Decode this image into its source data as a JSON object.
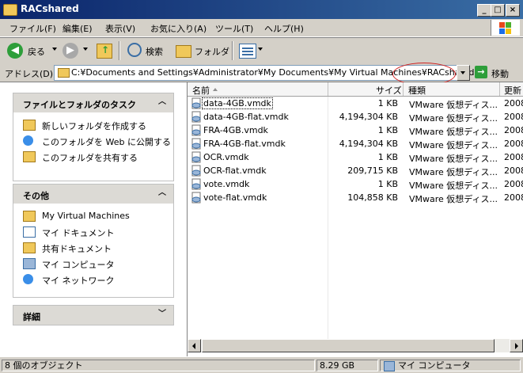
{
  "window": {
    "title": "RACshared"
  },
  "menu": [
    "ファイル(F)",
    "編集(E)",
    "表示(V)",
    "お気に入り(A)",
    "ツール(T)",
    "ヘルプ(H)"
  ],
  "toolbar": {
    "back": "戻る",
    "search": "検索",
    "folders": "フォルダ"
  },
  "address": {
    "label": "アドレス(D)",
    "path": "C:¥Documents and Settings¥Administrator¥My Documents¥My Virtual Machines¥RACshared",
    "go": "移動"
  },
  "tasks": {
    "title": "ファイルとフォルダのタスク",
    "items": [
      "新しいフォルダを作成する",
      "このフォルダを Web に公開する",
      "このフォルダを共有する"
    ]
  },
  "other": {
    "title": "その他",
    "items": [
      "My Virtual Machines",
      "マイ ドキュメント",
      "共有ドキュメント",
      "マイ コンピュータ",
      "マイ ネットワーク"
    ]
  },
  "details": {
    "title": "詳細"
  },
  "columns": {
    "name": "名前",
    "size": "サイズ",
    "type": "種類",
    "date": "更新"
  },
  "files": [
    {
      "name": "data-4GB.vmdk",
      "size": "1 KB",
      "type": "VMware 仮想ディス...",
      "date": "2008"
    },
    {
      "name": "data-4GB-flat.vmdk",
      "size": "4,194,304 KB",
      "type": "VMware 仮想ディス...",
      "date": "2008"
    },
    {
      "name": "FRA-4GB.vmdk",
      "size": "1 KB",
      "type": "VMware 仮想ディス...",
      "date": "2008"
    },
    {
      "name": "FRA-4GB-flat.vmdk",
      "size": "4,194,304 KB",
      "type": "VMware 仮想ディス...",
      "date": "2008"
    },
    {
      "name": "OCR.vmdk",
      "size": "1 KB",
      "type": "VMware 仮想ディス...",
      "date": "2008"
    },
    {
      "name": "OCR-flat.vmdk",
      "size": "209,715 KB",
      "type": "VMware 仮想ディス...",
      "date": "2008"
    },
    {
      "name": "vote.vmdk",
      "size": "1 KB",
      "type": "VMware 仮想ディス...",
      "date": "2008"
    },
    {
      "name": "vote-flat.vmdk",
      "size": "104,858 KB",
      "type": "VMware 仮想ディス...",
      "date": "2008"
    }
  ],
  "status": {
    "count": "8 個のオブジェクト",
    "size": "8.29 GB",
    "location": "マイ コンピュータ"
  },
  "colors": {
    "titlebar": "#0a246a",
    "highlight": "#d02020",
    "chrome": "#d4d0c8"
  }
}
